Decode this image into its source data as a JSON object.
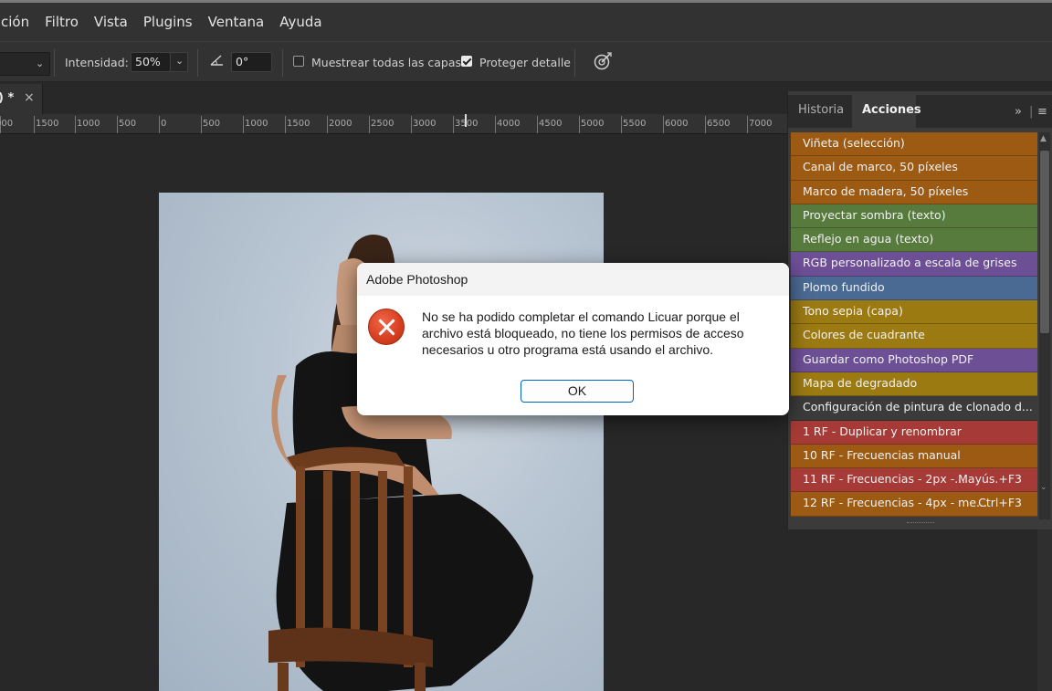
{
  "menu": [
    "ción",
    "Filtro",
    "Vista",
    "Plugins",
    "Ventana",
    "Ayuda"
  ],
  "options": {
    "intensity_label": "Intensidad:",
    "intensity_value": "50%",
    "angle_value": "0°",
    "sample_all_label": "Muestrear todas las capas",
    "sample_all_checked": false,
    "protect_detail_label": "Proteger detalle",
    "protect_detail_checked": true
  },
  "document_tab": {
    "label": ") *",
    "close": "×"
  },
  "ruler_labels": [
    "000",
    "1500",
    "1000",
    "500",
    "0",
    "500",
    "1000",
    "1500",
    "2000",
    "2500",
    "3000",
    "3500",
    "4000",
    "4500",
    "5000",
    "5500",
    "6000",
    "6500",
    "7000"
  ],
  "panel": {
    "tabs": [
      "Historia",
      "Acciones"
    ],
    "active_tab": "Acciones",
    "actions": [
      {
        "label": "Viñeta (selección)",
        "color": "#9c5a12",
        "shortcut": ""
      },
      {
        "label": "Canal de marco, 50 píxeles",
        "color": "#9c5a12",
        "shortcut": ""
      },
      {
        "label": "Marco de madera, 50 píxeles",
        "color": "#9c5a12",
        "shortcut": ""
      },
      {
        "label": "Proyectar sombra (texto)",
        "color": "#577a3d",
        "shortcut": ""
      },
      {
        "label": "Reflejo en agua (texto)",
        "color": "#577a3d",
        "shortcut": ""
      },
      {
        "label": "RGB personalizado a escala de grises",
        "color": "#6d4f96",
        "shortcut": ""
      },
      {
        "label": "Plomo fundido",
        "color": "#4b6a93",
        "shortcut": ""
      },
      {
        "label": "Tono sepia (capa)",
        "color": "#9c7a12",
        "shortcut": ""
      },
      {
        "label": "Colores de cuadrante",
        "color": "#9c7a12",
        "shortcut": ""
      },
      {
        "label": "Guardar como Photoshop PDF",
        "color": "#6d4f96",
        "shortcut": ""
      },
      {
        "label": "Mapa de degradado",
        "color": "#9c7a12",
        "shortcut": ""
      },
      {
        "label": "Configuración de pintura de clonado d...",
        "color": "#3b3b3b",
        "shortcut": ""
      },
      {
        "label": "1 RF - Duplicar y renombrar",
        "color": "#a53a36",
        "shortcut": ""
      },
      {
        "label": "10 RF - Frecuencias manual",
        "color": "#9c5a12",
        "shortcut": ""
      },
      {
        "label": "11 RF - Frecuencias - 2px -...",
        "color": "#a53a36",
        "shortcut": "Mayús.+F3"
      },
      {
        "label": "12 RF - Frecuencias - 4px - me...",
        "color": "#9c5a12",
        "shortcut": "Ctrl+F3"
      }
    ]
  },
  "dialog": {
    "title": "Adobe Photoshop",
    "message_lines": [
      "No se ha podido completar el comando Licuar porque el",
      "archivo está bloqueado, no tiene los permisos de acceso",
      "necesarios u otro programa está usando el archivo."
    ],
    "ok_label": "OK"
  }
}
